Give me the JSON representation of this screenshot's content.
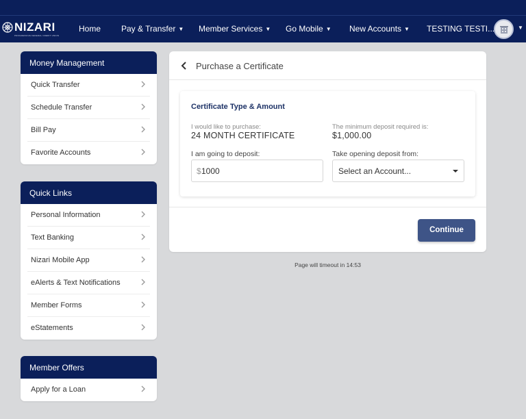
{
  "brand": {
    "name": "NIZARI",
    "tagline": "PROGRESSIVE FEDERAL CREDIT UNION"
  },
  "nav": {
    "items": [
      {
        "label": "Home",
        "dropdown": false
      },
      {
        "label": "Pay & Transfer",
        "dropdown": true
      },
      {
        "label": "Member Services",
        "dropdown": true
      },
      {
        "label": "Go Mobile",
        "dropdown": true
      },
      {
        "label": "New Accounts",
        "dropdown": true
      }
    ],
    "user_label": "TESTING TESTI...",
    "avatar_icon": "bank-building-icon"
  },
  "sidebar": {
    "money_management": {
      "title": "Money Management",
      "items": [
        "Quick Transfer",
        "Schedule Transfer",
        "Bill Pay",
        "Favorite Accounts"
      ]
    },
    "quick_links": {
      "title": "Quick Links",
      "items": [
        "Personal Information",
        "Text Banking",
        "Nizari Mobile App",
        "eAlerts & Text Notifications",
        "Member Forms",
        "eStatements"
      ]
    },
    "member_offers": {
      "title": "Member Offers",
      "items": [
        "Apply for a Loan"
      ]
    }
  },
  "main": {
    "title": "Purchase a Certificate",
    "section_title": "Certificate Type & Amount",
    "purchase_label": "I would like to purchase:",
    "purchase_value": "24 MONTH CERTIFICATE",
    "min_label": "The minimum deposit required is:",
    "min_value": "$1,000.00",
    "deposit_label": "I am going to deposit:",
    "currency_symbol": "$",
    "deposit_value": "1000",
    "from_label": "Take opening deposit from:",
    "from_selected": "Select an Account...",
    "continue_label": "Continue",
    "timeout_text": "Page will timeout in 14:53"
  },
  "colors": {
    "navy": "#0b1f5a",
    "button": "#3e5487",
    "background": "#d8d9db"
  }
}
